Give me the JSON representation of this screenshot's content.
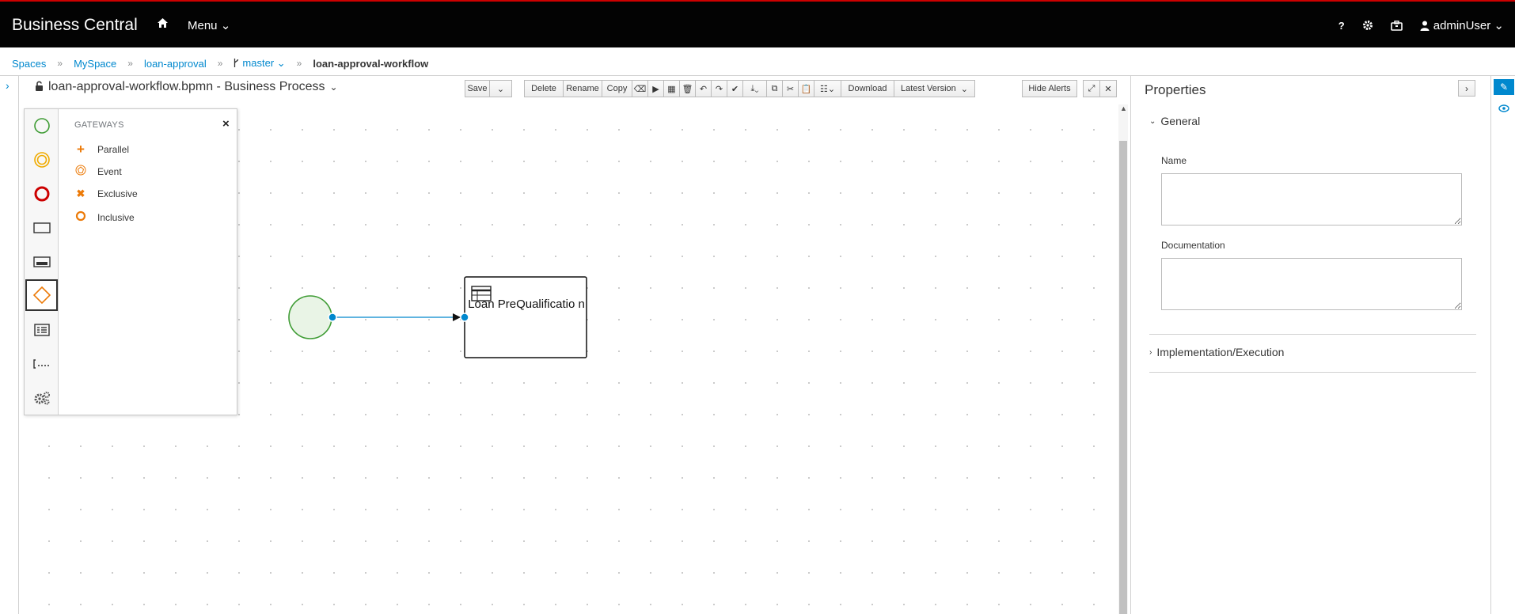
{
  "topbar": {
    "brand": "Business Central",
    "menu_label": "Menu ⌄",
    "help_label": "?",
    "user_label": "adminUser ⌄"
  },
  "breadcrumb": {
    "items": [
      "Spaces",
      "MySpace",
      "loan-approval",
      "master ⌄",
      "loan-approval-workflow"
    ]
  },
  "editor": {
    "title": "loan-approval-workflow.bpmn - Business Process",
    "toolbar": {
      "save": "Save",
      "delete": "Delete",
      "rename": "Rename",
      "copy": "Copy",
      "download": "Download",
      "latest_version": "Latest Version",
      "hide_alerts": "Hide Alerts"
    }
  },
  "palette": {
    "heading": "GATEWAYS",
    "close": "×",
    "gateways": [
      "Parallel",
      "Event",
      "Exclusive",
      "Inclusive"
    ]
  },
  "diagram": {
    "task_label": "Loan PreQualificatio n"
  },
  "properties": {
    "title": "Properties",
    "general_section": "General",
    "name_label": "Name",
    "documentation_label": "Documentation",
    "implementation_section": "Implementation/Execution"
  },
  "colors": {
    "accent": "#0088ce",
    "gateway": "#ec7a08",
    "start_event": "#3f9c35",
    "end_event": "#cc0000",
    "topbar": "#030303"
  }
}
